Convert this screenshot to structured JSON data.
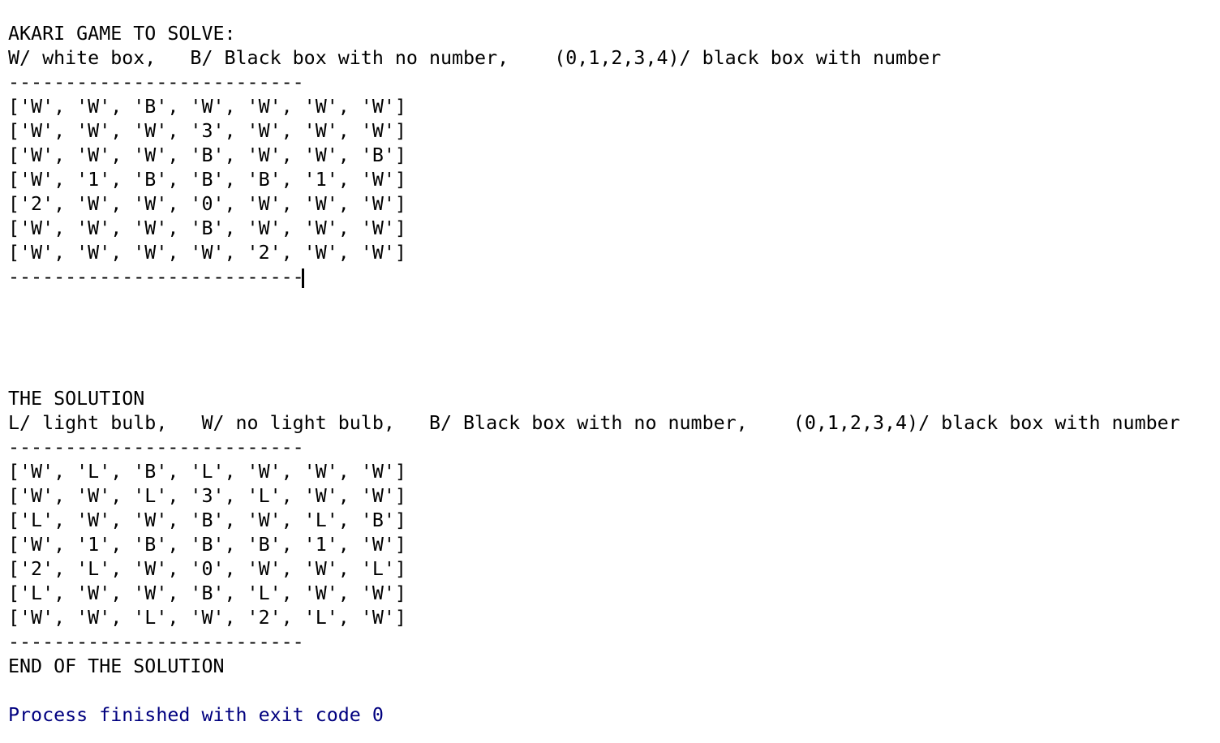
{
  "puzzle": {
    "heading": "AKARI GAME TO SOLVE:",
    "legend": "W/ white box,   B/ Black box with no number,    (0,1,2,3,4)/ black box with number",
    "separator_top": "--------------------------",
    "rows": [
      "['W', 'W', 'B', 'W', 'W', 'W', 'W']",
      "['W', 'W', 'W', '3', 'W', 'W', 'W']",
      "['W', 'W', 'W', 'B', 'W', 'W', 'B']",
      "['W', '1', 'B', 'B', 'B', '1', 'W']",
      "['2', 'W', 'W', '0', 'W', 'W', 'W']",
      "['W', 'W', 'W', 'B', 'W', 'W', 'W']",
      "['W', 'W', 'W', 'W', '2', 'W', 'W']"
    ],
    "separator_bottom": "--------------------------"
  },
  "solution": {
    "heading": "THE SOLUTION",
    "legend": "L/ light bulb,   W/ no light bulb,   B/ Black box with no number,    (0,1,2,3,4)/ black box with number",
    "separator_top": "--------------------------",
    "rows": [
      "['W', 'L', 'B', 'L', 'W', 'W', 'W']",
      "['W', 'W', 'L', '3', 'L', 'W', 'W']",
      "['L', 'W', 'W', 'B', 'W', 'L', 'B']",
      "['W', '1', 'B', 'B', 'B', '1', 'W']",
      "['2', 'L', 'W', '0', 'W', 'W', 'L']",
      "['L', 'W', 'W', 'B', 'L', 'W', 'W']",
      "['W', 'W', 'L', 'W', '2', 'L', 'W']"
    ],
    "separator_bottom": "--------------------------",
    "footer": "END OF THE SOLUTION"
  },
  "process": {
    "exit_message": "Process finished with exit code 0",
    "exit_color": "#00007f"
  }
}
